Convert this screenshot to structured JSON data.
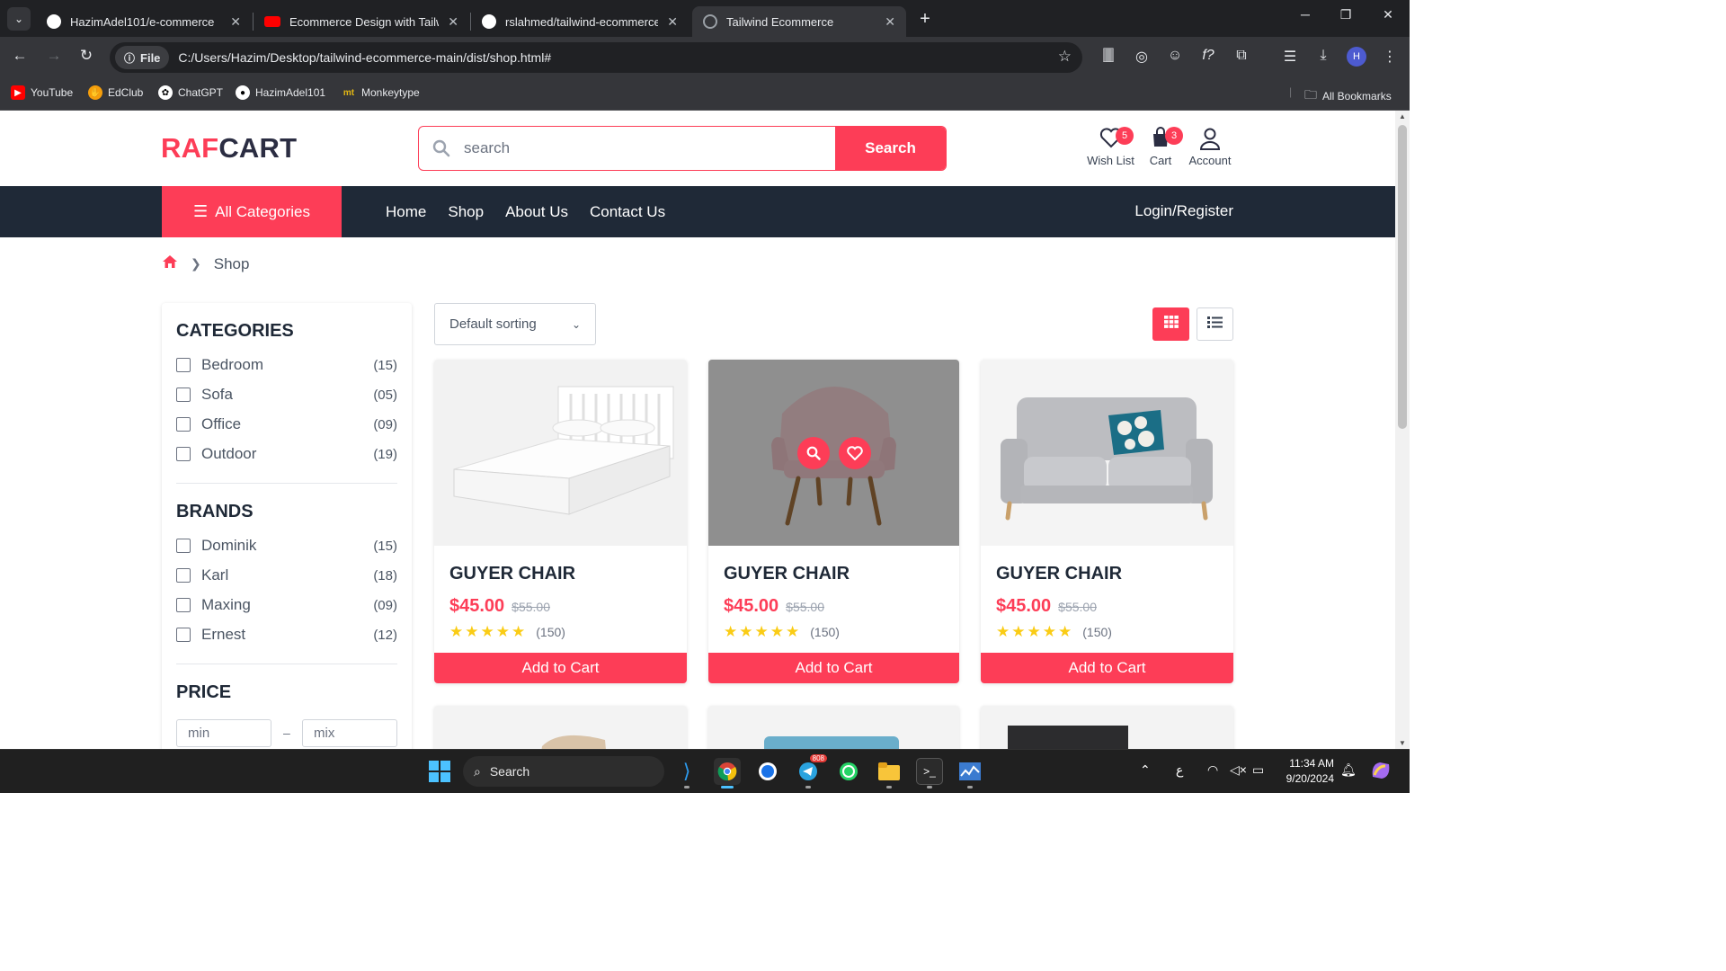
{
  "browser": {
    "tabs": [
      {
        "title": "HazimAdel101/e-commerce",
        "icon": "github-icon",
        "close": "✕"
      },
      {
        "title": "Ecommerce Design with Tailwind",
        "icon": "youtube-icon",
        "close": "✕"
      },
      {
        "title": "rslahmed/tailwind-ecommerce",
        "icon": "github-icon",
        "close": "✕"
      },
      {
        "title": "Tailwind Ecommerce",
        "icon": "globe-icon",
        "close": "✕"
      }
    ],
    "new_tab": "+",
    "file_chip": "File",
    "url": "C:/Users/Hazim/Desktop/tailwind-ecommerce-main/dist/shop.html#",
    "profile_initial": "H",
    "bookmarks": [
      {
        "label": "YouTube",
        "icon": "youtube-icon",
        "color": "#ff0000"
      },
      {
        "label": "EdClub",
        "icon": "edclub-icon",
        "color": "#f59e0b"
      },
      {
        "label": "ChatGPT",
        "icon": "chatgpt-icon",
        "color": "#10a37f"
      },
      {
        "label": "HazimAdel101",
        "icon": "github-icon",
        "color": "#24292f"
      },
      {
        "label": "Monkeytype",
        "icon": "monkeytype-icon",
        "color": "#e2b714"
      }
    ],
    "all_bookmarks": "All Bookmarks"
  },
  "site": {
    "logo_part1": "RAF",
    "logo_part2": "CART",
    "search_placeholder": "search",
    "search_button": "Search",
    "wishlist_label": "Wish List",
    "wishlist_count": "5",
    "cart_label": "Cart",
    "cart_count": "3",
    "account_label": "Account",
    "all_categories": "All Categories",
    "nav": [
      "Home",
      "Shop",
      "About Us",
      "Contact Us"
    ],
    "login": "Login/Register",
    "breadcrumb_current": "Shop",
    "accent": "#fd3d57",
    "dark": "#1f2937"
  },
  "sidebar": {
    "categories_title": "CATEGORIES",
    "categories": [
      {
        "label": "Bedroom",
        "count": "(15)"
      },
      {
        "label": "Sofa",
        "count": "(05)"
      },
      {
        "label": "Office",
        "count": "(09)"
      },
      {
        "label": "Outdoor",
        "count": "(19)"
      }
    ],
    "brands_title": "BRANDS",
    "brands": [
      {
        "label": "Dominik",
        "count": "(15)"
      },
      {
        "label": "Karl",
        "count": "(18)"
      },
      {
        "label": "Maxing",
        "count": "(09)"
      },
      {
        "label": "Ernest",
        "count": "(12)"
      }
    ],
    "price_title": "PRICE",
    "price_min_placeholder": "min",
    "price_max_placeholder": "mix",
    "price_sep": "–"
  },
  "shop": {
    "sort_value": "Default sorting",
    "products": [
      {
        "name": "GUYER CHAIR",
        "price": "$45.00",
        "old_price": "$55.00",
        "rating": 5,
        "reviews": "(150)",
        "button": "Add to Cart",
        "image": "bed"
      },
      {
        "name": "GUYER CHAIR",
        "price": "$45.00",
        "old_price": "$55.00",
        "rating": 5,
        "reviews": "(150)",
        "button": "Add to Cart",
        "image": "armchair"
      },
      {
        "name": "GUYER CHAIR",
        "price": "$45.00",
        "old_price": "$55.00",
        "rating": 5,
        "reviews": "(150)",
        "button": "Add to Cart",
        "image": "sofa"
      }
    ]
  },
  "taskbar": {
    "search": "Search",
    "telegram_badge": "808",
    "time": "11:34 AM",
    "date": "9/20/2024",
    "lang": "ع"
  }
}
